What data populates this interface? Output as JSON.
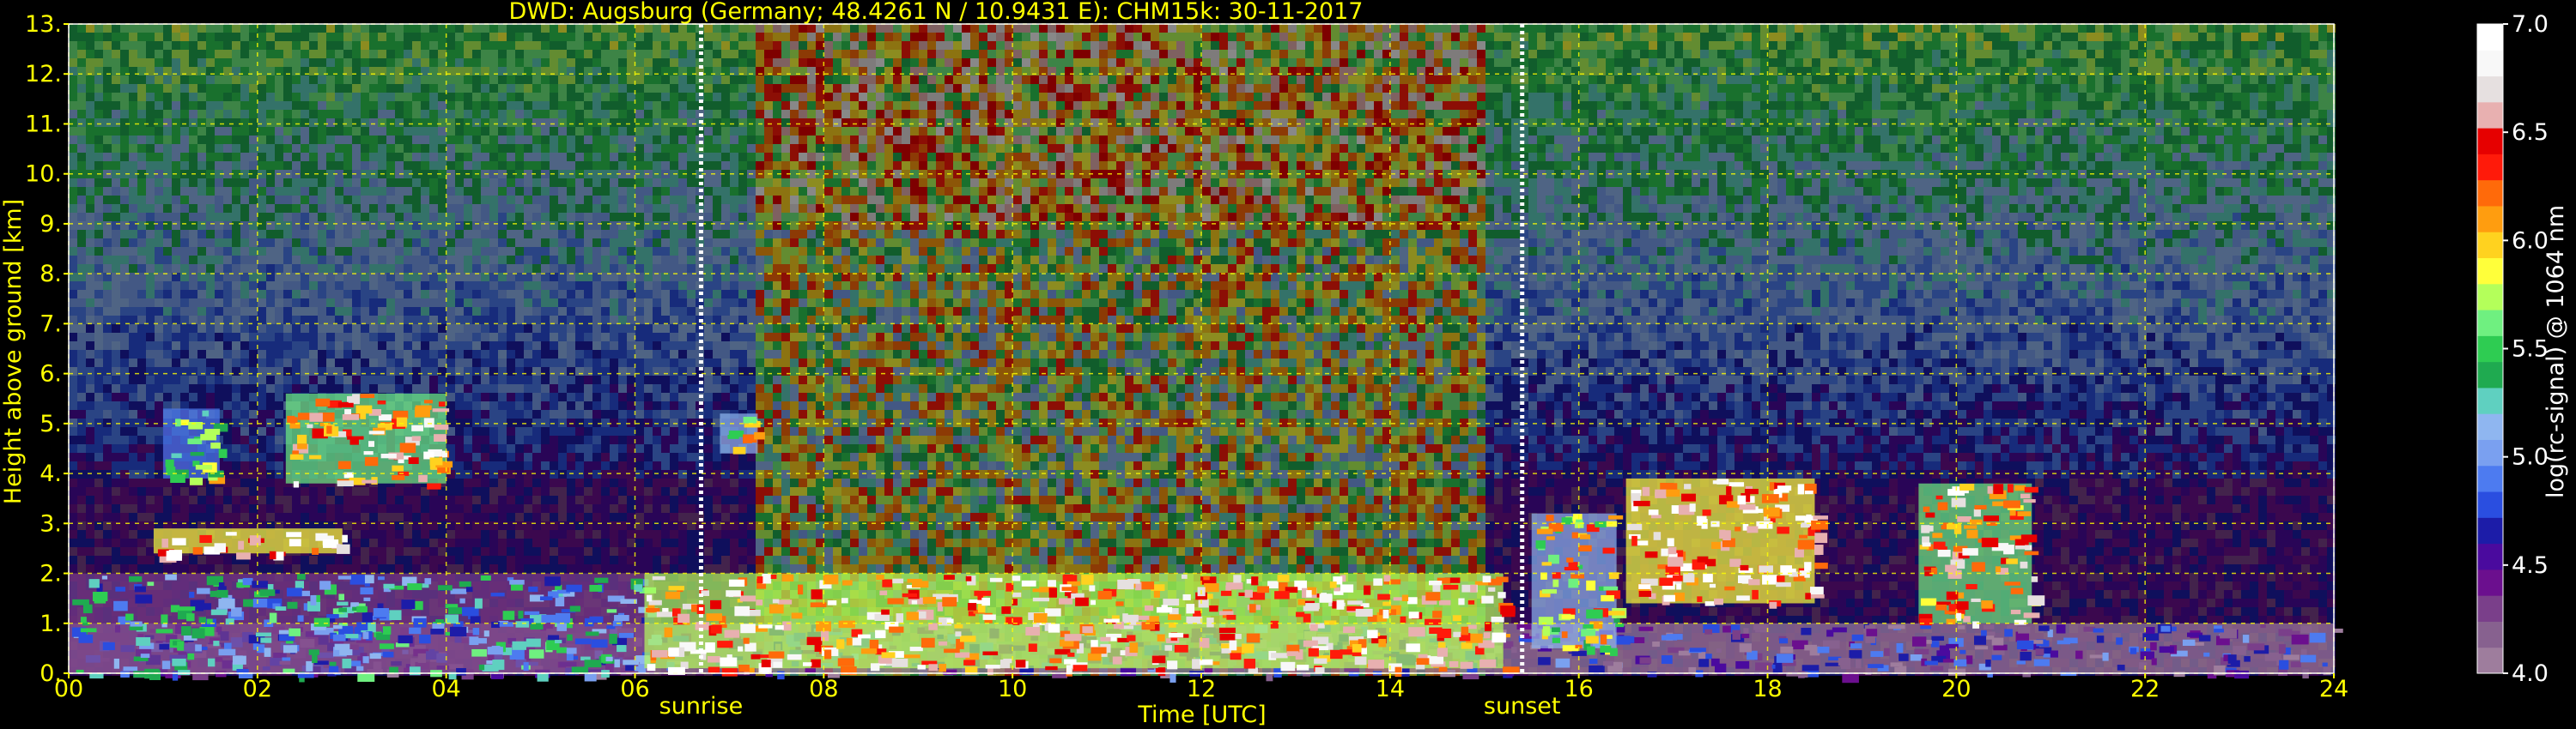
{
  "chart_data": {
    "type": "heatmap",
    "title": "DWD: Augsburg (Germany; 48.4261 N / 10.9431 E):    CHM15k: 30-11-2017",
    "xlabel": "Time [UTC]",
    "ylabel": "Height above ground [km]",
    "colorbar_label": "log(rc-signal) @ 1064 nm",
    "xlim": [
      0,
      24
    ],
    "ylim": [
      0,
      13
    ],
    "clim": [
      4.0,
      7.0
    ],
    "x_ticks": [
      "00",
      "02",
      "04",
      "06",
      "08",
      "10",
      "12",
      "14",
      "16",
      "18",
      "20",
      "22",
      "24"
    ],
    "y_ticks": [
      "0.",
      "1.",
      "2.",
      "3.",
      "4.",
      "5.",
      "6.",
      "7.",
      "8.",
      "9.",
      "10.",
      "11.",
      "12.",
      "13."
    ],
    "colorbar_ticks": [
      "4.0",
      "4.5",
      "5.0",
      "5.5",
      "6.0",
      "6.5",
      "7.0"
    ],
    "grid": true,
    "grid_color": "#ffff00",
    "markers": [
      {
        "label": "sunrise",
        "time": 6.7
      },
      {
        "label": "sunset",
        "time": 15.4
      }
    ],
    "colormap": [
      "#9e7d9d",
      "#87618f",
      "#7a3f8a",
      "#6b0f8e",
      "#4a0a9e",
      "#1c1ca8",
      "#2a4ee0",
      "#4d7bf0",
      "#7aa0f0",
      "#8fb6f0",
      "#5fd0c0",
      "#1faa50",
      "#2ecc52",
      "#6ff080",
      "#b4ff5a",
      "#ffff3a",
      "#ffd21f",
      "#ff9d0f",
      "#ff6a0a",
      "#ff1a0a",
      "#e60000",
      "#e8b0b0",
      "#e6e0e0",
      "#f8f8f8",
      "#ffffff"
    ],
    "features": [
      {
        "kind": "boundary-layer",
        "start": 0,
        "end": 24,
        "top_km": 1.0,
        "level": 4.6
      },
      {
        "kind": "aerosol-layer",
        "start": 0,
        "end": 6.2,
        "top_km": 2.0,
        "level": 5.2
      },
      {
        "kind": "cloud",
        "start": 2.3,
        "end": 4.0,
        "bottom_km": 3.8,
        "top_km": 5.6,
        "level": 6.5
      },
      {
        "kind": "cloud",
        "start": 1.0,
        "end": 1.6,
        "bottom_km": 3.9,
        "top_km": 5.3,
        "level": 5.8
      },
      {
        "kind": "cloud",
        "start": 0.9,
        "end": 2.9,
        "bottom_km": 2.4,
        "top_km": 2.9,
        "level": 6.8
      },
      {
        "kind": "cloud",
        "start": 6.9,
        "end": 7.3,
        "bottom_km": 4.4,
        "top_km": 5.2,
        "level": 6.0
      },
      {
        "kind": "precipitation-noise",
        "start": 7.2,
        "end": 15.0,
        "bottom_km": 0,
        "top_km": 13,
        "level": 5.6
      },
      {
        "kind": "low-cloud",
        "start": 6.1,
        "end": 15.2,
        "bottom_km": 0.1,
        "top_km": 2.0,
        "level": 6.6
      },
      {
        "kind": "cloud",
        "start": 16.5,
        "end": 18.5,
        "bottom_km": 1.4,
        "top_km": 3.9,
        "level": 6.7
      },
      {
        "kind": "cloud",
        "start": 19.6,
        "end": 20.8,
        "bottom_km": 1.0,
        "top_km": 3.8,
        "level": 6.5
      },
      {
        "kind": "cloud",
        "start": 15.5,
        "end": 16.4,
        "bottom_km": 0.5,
        "top_km": 3.2,
        "level": 6.0
      }
    ]
  }
}
